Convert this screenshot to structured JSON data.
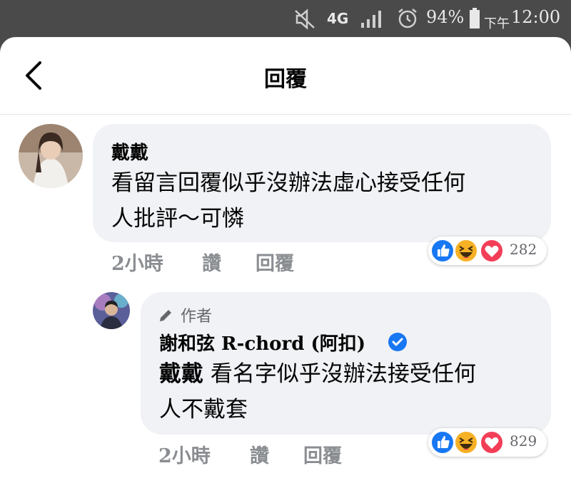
{
  "status_bar": {
    "network": "4G",
    "battery": "94%",
    "period": "下午",
    "time": "12:00"
  },
  "header": {
    "title": "回覆"
  },
  "comments": [
    {
      "author": "戴戴",
      "text_line1": "看留言回覆似乎沒辦法虛心接受任何",
      "text_line2": "人批評～可憐",
      "time": "2小時",
      "like_label": "讚",
      "reply_label": "回覆",
      "reaction_count": "282",
      "reactions": [
        "like-icon",
        "haha-icon",
        "love-icon"
      ]
    },
    {
      "author_badge": "作者",
      "author": "謝和弦 R-chord (阿扣)",
      "verified": true,
      "mention": "戴戴",
      "text_line1_rest": " 看名字似乎沒辦法接受任何",
      "text_line2": "人不戴套",
      "time": "2小時",
      "like_label": "讚",
      "reply_label": "回覆",
      "reaction_count": "829",
      "reactions": [
        "like-icon",
        "haha-icon",
        "love-icon"
      ]
    }
  ],
  "colors": {
    "like_blue": "#1877f2",
    "haha_yellow": "#f7b125",
    "love_red": "#f33e58",
    "verified_blue": "#1877f2",
    "bubble_bg": "#f0f2f5"
  }
}
